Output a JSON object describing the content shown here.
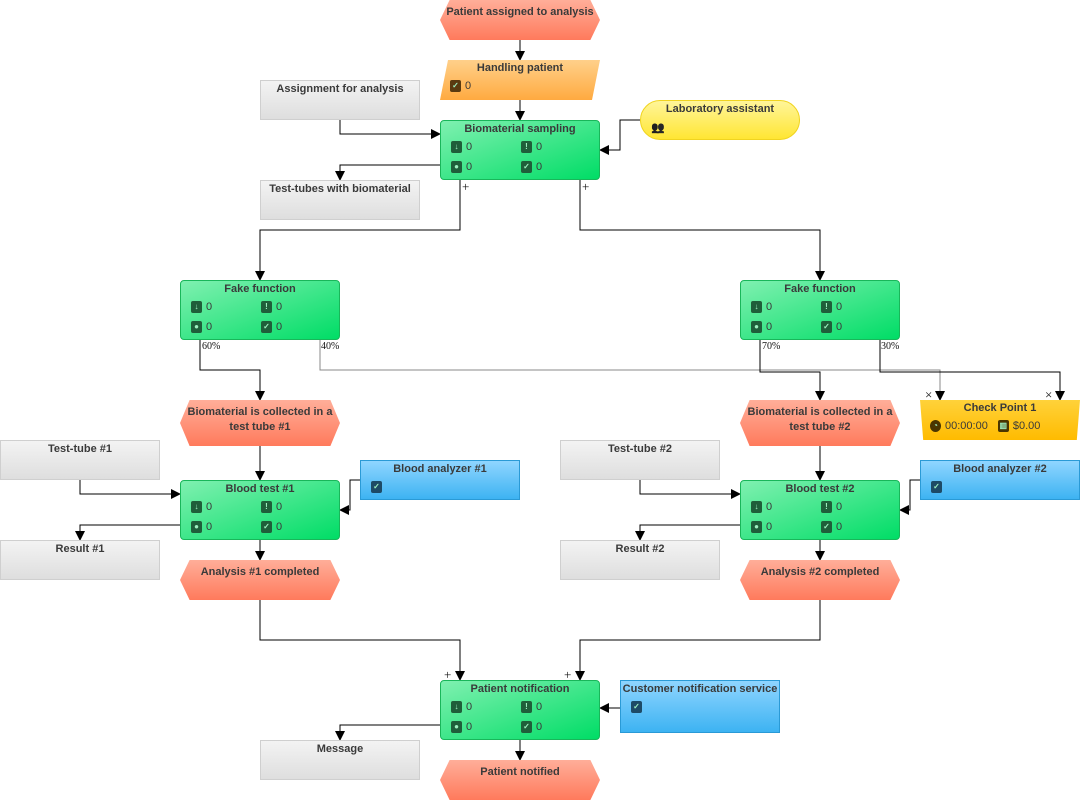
{
  "nodes": {
    "patient_assigned": {
      "type": "event",
      "title": "Patient assigned to analysis"
    },
    "handling_patient": {
      "type": "process",
      "title": "Handling patient",
      "count": "0"
    },
    "assignment": {
      "type": "document",
      "title": "Assignment for analysis"
    },
    "lab_assistant": {
      "type": "role",
      "title": "Laboratory assistant",
      "icon": "people-icon"
    },
    "bio_sampling": {
      "type": "function",
      "title": "Biomaterial sampling",
      "in": "0",
      "alert": "0",
      "user": "0",
      "done": "0"
    },
    "test_tubes": {
      "type": "document",
      "title": "Test-tubes with biomaterial"
    },
    "fake1": {
      "type": "function",
      "title": "Fake function",
      "in": "0",
      "alert": "0",
      "user": "0",
      "done": "0"
    },
    "fake2": {
      "type": "function",
      "title": "Fake function",
      "in": "0",
      "alert": "0",
      "user": "0",
      "done": "0"
    },
    "collected1": {
      "type": "event",
      "title": "Biomaterial is collected in a test tube #1"
    },
    "collected2": {
      "type": "event",
      "title": "Biomaterial is collected in a test tube #2"
    },
    "checkpoint": {
      "type": "checkpoint",
      "title": "Check Point 1",
      "time": "00:00:00",
      "cost": "$0.00"
    },
    "tube1": {
      "type": "document",
      "title": "Test-tube #1"
    },
    "tube2": {
      "type": "document",
      "title": "Test-tube #2"
    },
    "analyzer1": {
      "type": "resource",
      "title": "Blood analyzer #1"
    },
    "analyzer2": {
      "type": "resource",
      "title": "Blood analyzer #2"
    },
    "blood1": {
      "type": "function",
      "title": "Blood test #1",
      "in": "0",
      "alert": "0",
      "user": "0",
      "done": "0"
    },
    "blood2": {
      "type": "function",
      "title": "Blood test #2",
      "in": "0",
      "alert": "0",
      "user": "0",
      "done": "0"
    },
    "result1": {
      "type": "document",
      "title": "Result #1"
    },
    "result2": {
      "type": "document",
      "title": "Result #2"
    },
    "completed1": {
      "type": "event",
      "title": "Analysis #1 completed"
    },
    "completed2": {
      "type": "event",
      "title": "Analysis #2 completed"
    },
    "notification": {
      "type": "function",
      "title": "Patient notification",
      "in": "0",
      "alert": "0",
      "user": "0",
      "done": "0"
    },
    "customer_service": {
      "type": "resource",
      "title": "Customer notification service"
    },
    "message": {
      "type": "document",
      "title": "Message"
    },
    "notified": {
      "type": "event",
      "title": "Patient notified"
    }
  },
  "edge_labels": {
    "fake1_left": "60%",
    "fake1_right": "40%",
    "fake2_left": "70%",
    "fake2_right": "30%",
    "plus": "+",
    "cross": "×"
  },
  "colors": {
    "function": "#00dd66",
    "event": "#ff7a5c",
    "document": "#e6e6e6",
    "resource": "#3db3f2",
    "role": "#ffe633",
    "process": "#ffaa40",
    "checkpoint": "#ffbb00"
  }
}
